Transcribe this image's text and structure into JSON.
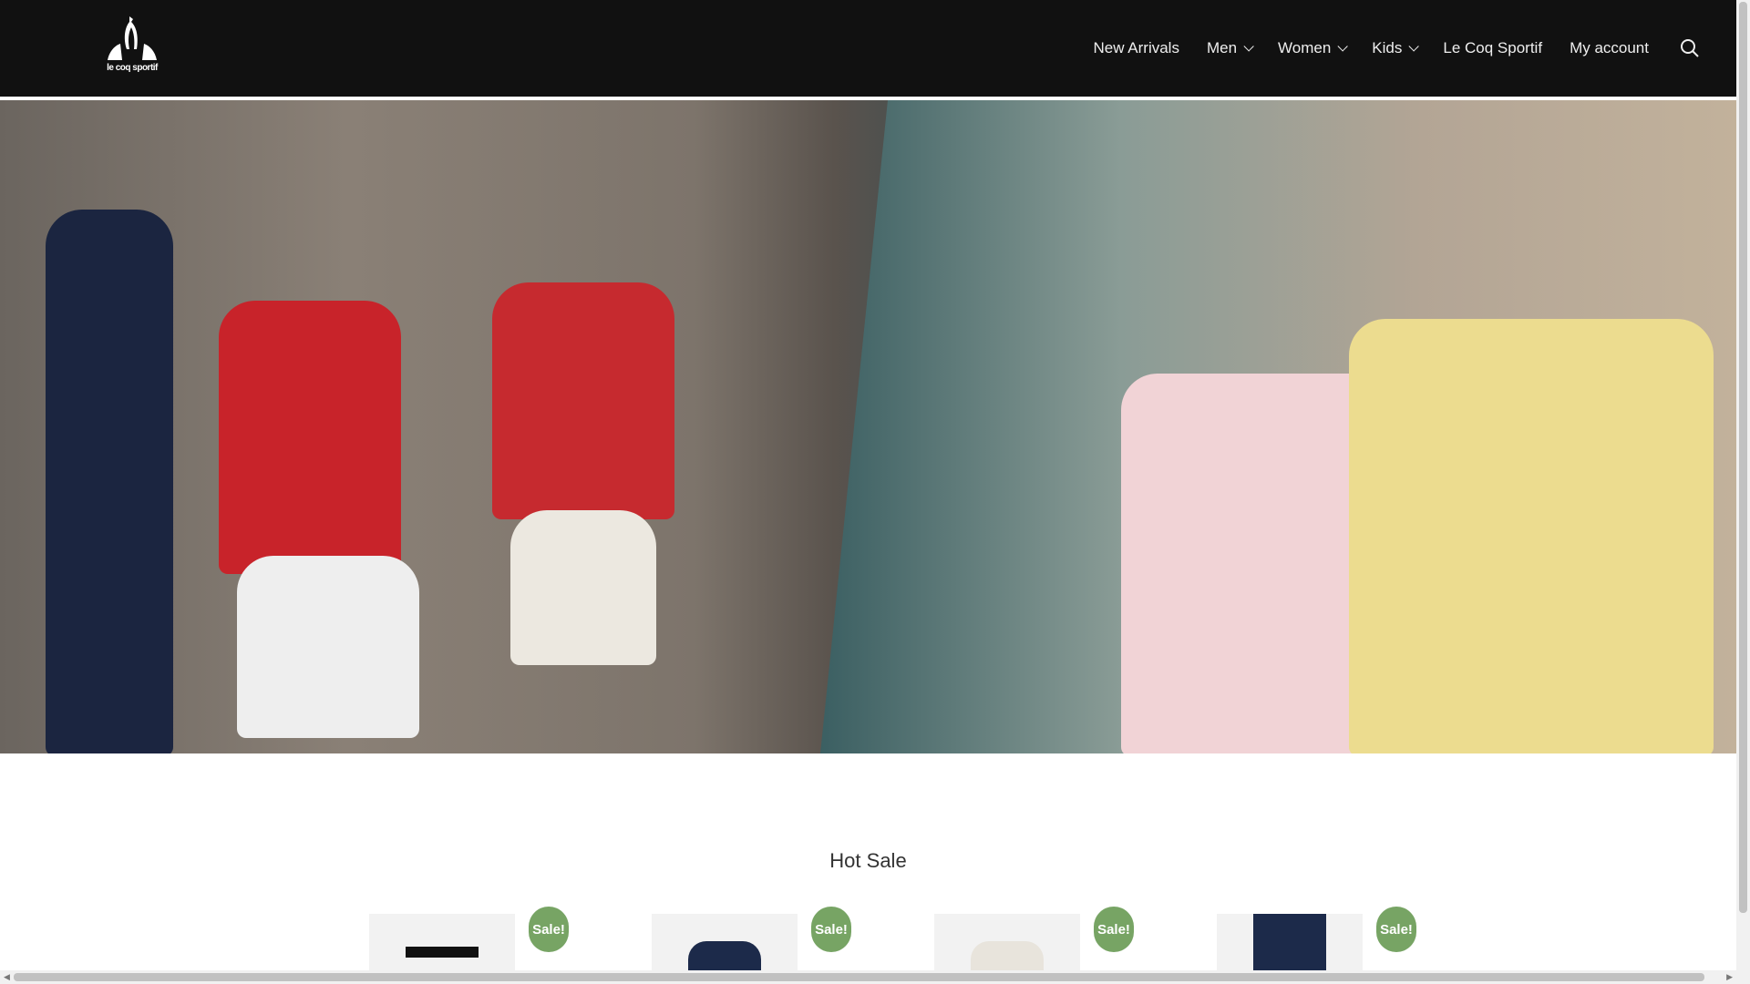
{
  "header": {
    "logo_text": "le coq sportif",
    "nav": [
      {
        "label": "New Arrivals",
        "dropdown": false
      },
      {
        "label": "Men",
        "dropdown": true
      },
      {
        "label": "Women",
        "dropdown": true
      },
      {
        "label": "Kids",
        "dropdown": true
      },
      {
        "label": "Le Coq Sportif",
        "dropdown": false
      },
      {
        "label": "My account",
        "dropdown": false
      }
    ],
    "search_icon": "search-icon"
  },
  "hot_sale": {
    "title": "Hot Sale",
    "products": [
      {
        "badge": "Sale!"
      },
      {
        "badge": "Sale!"
      },
      {
        "badge": "Sale!"
      },
      {
        "badge": "Sale!"
      }
    ]
  },
  "colors": {
    "header_bg": "#111111",
    "sale_badge": "#77a464"
  }
}
